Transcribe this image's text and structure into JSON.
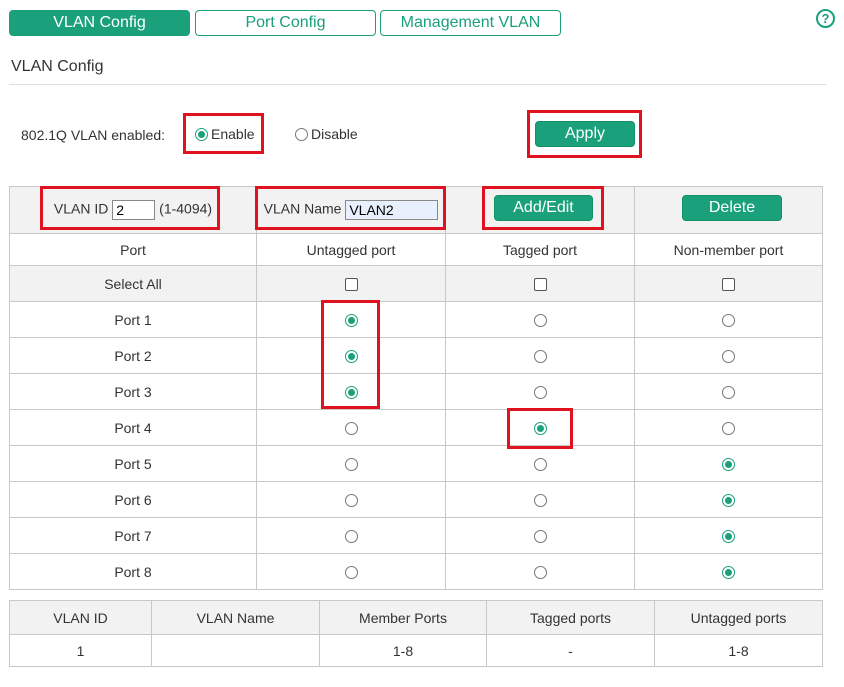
{
  "tabs": [
    {
      "label": "VLAN Config",
      "active": true
    },
    {
      "label": "Port Config",
      "active": false
    },
    {
      "label": "Management VLAN",
      "active": false
    }
  ],
  "help_icon": "question-circle-icon",
  "section_title": "VLAN Config",
  "vlan_enable": {
    "label": "802.1Q VLAN enabled:",
    "enable_label": "Enable",
    "disable_label": "Disable",
    "selected": "Enable"
  },
  "apply_label": "Apply",
  "form": {
    "vlan_id_label": "VLAN ID",
    "vlan_id_value": "2",
    "vlan_id_range": "(1-4094)",
    "vlan_name_label": "VLAN Name",
    "vlan_name_value": "VLAN2",
    "add_edit_label": "Add/Edit",
    "delete_label": "Delete"
  },
  "port_table": {
    "headers": [
      "Port",
      "Untagged port",
      "Tagged port",
      "Non-member port"
    ],
    "select_all_label": "Select All",
    "ports": [
      {
        "name": "Port 1",
        "selection": "untagged"
      },
      {
        "name": "Port 2",
        "selection": "untagged"
      },
      {
        "name": "Port 3",
        "selection": "untagged"
      },
      {
        "name": "Port 4",
        "selection": "tagged"
      },
      {
        "name": "Port 5",
        "selection": "nonmember"
      },
      {
        "name": "Port 6",
        "selection": "nonmember"
      },
      {
        "name": "Port 7",
        "selection": "nonmember"
      },
      {
        "name": "Port 8",
        "selection": "nonmember"
      }
    ]
  },
  "vlan_table": {
    "headers": [
      "VLAN ID",
      "VLAN Name",
      "Member Ports",
      "Tagged ports",
      "Untagged ports"
    ],
    "rows": [
      [
        "1",
        "",
        "1-8",
        "-",
        "1-8"
      ]
    ]
  },
  "colors": {
    "accent": "#1aa07a",
    "highlight": "#e0121f"
  }
}
